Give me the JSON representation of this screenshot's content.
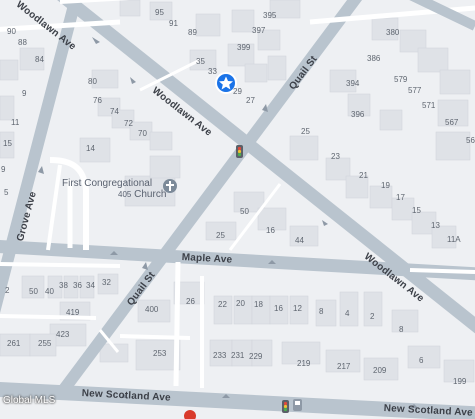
{
  "map": {
    "marker_icon": "star-marker",
    "poi_icon": "church-icon",
    "traffic_signal_icon": "traffic-light-icon",
    "colors": {
      "background": "#eef0f3",
      "road_major": "#b9c4ce",
      "road_minor": "#ffffff",
      "building": "#dfe2e7",
      "marker": "#1a73e8",
      "poi": "#7c8a99"
    },
    "streets": {
      "woodlawn_ave_top": "Woodlawn Ave",
      "woodlawn_ave_mid": "Woodlawn Ave",
      "woodlawn_ave_right": "Woodlawn Ave",
      "quail_st_top": "Quail St",
      "quail_st_bottom": "Quail St",
      "maple_ave": "Maple Ave",
      "grove_ave": "Grove Ave",
      "new_scotland_ave": "New Scotland Ave",
      "new_scotland_ave_right": "New Scotland Ave"
    },
    "poi": {
      "name_line1": "First Congregational",
      "name_line2": "Church",
      "number": "405"
    },
    "house_numbers": {
      "n95": "95",
      "n91": "91",
      "n89": "89",
      "n395": "395",
      "n397": "397",
      "n399": "399",
      "n35": "35",
      "n33": "33",
      "n29": "29",
      "n27": "27",
      "n90": "90",
      "n88": "88",
      "n84": "84",
      "n9": "9",
      "n11": "11",
      "n15": "15",
      "n80": "80",
      "n76": "76",
      "n74": "74",
      "n72": "72",
      "n70": "70",
      "n14": "14",
      "n380": "380",
      "n386": "386",
      "n579": "579",
      "n577": "577",
      "n571": "571",
      "n394": "394",
      "n396": "396",
      "n567": "567",
      "n25a": "25",
      "n23": "23",
      "n21": "21",
      "n19": "19",
      "n17": "17",
      "n15b": "15",
      "n13": "13",
      "n11a": "11A",
      "n50": "50",
      "n16": "16",
      "n44": "44",
      "n25b": "25",
      "n50b": "50",
      "n40": "40",
      "n38": "38",
      "n36": "36",
      "n34": "34",
      "n32": "32",
      "n419": "419",
      "n423": "423",
      "n261": "261",
      "n255": "255",
      "n253": "253",
      "n400": "400",
      "n26": "26",
      "n22": "22",
      "n20": "20",
      "n18": "18",
      "n16b": "16",
      "n12": "12",
      "n8": "8",
      "n4": "4",
      "n2": "2",
      "n8b": "8",
      "n233": "233",
      "n231": "231",
      "n229": "229",
      "n219": "219",
      "n217": "217",
      "n209": "209",
      "n6": "6",
      "n199": "199",
      "n2a": "2",
      "n56": "56",
      "n9b": "9",
      "n5": "5"
    },
    "attribution": "Global MLS"
  }
}
